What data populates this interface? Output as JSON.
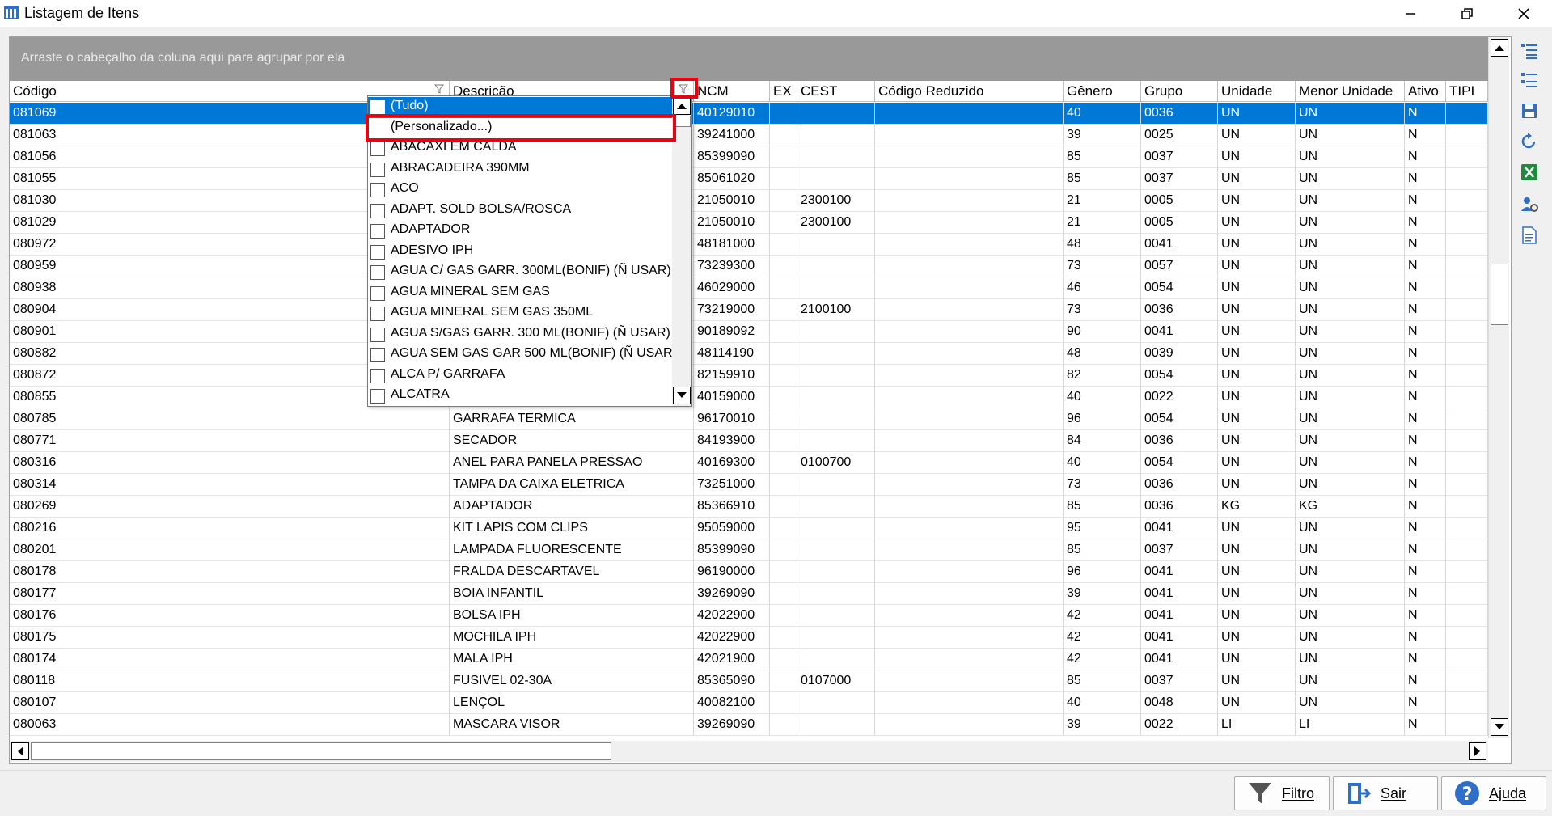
{
  "window": {
    "title": "Listagem de Itens"
  },
  "group_panel": {
    "hint": "Arraste o cabeçalho da coluna aqui para agrupar por ela"
  },
  "columns": [
    "Código",
    "Descrição",
    "NCM",
    "EX",
    "CEST",
    "Código Reduzido",
    "Gênero",
    "Grupo",
    "Unidade",
    "Menor Unidade",
    "Ativo",
    "TIPI"
  ],
  "rows": [
    {
      "codigo": "081069",
      "descricao": "",
      "ncm": "40129010",
      "ex": "",
      "cest": "",
      "reduzido": "",
      "genero": "40",
      "grupo": "0036",
      "unidade": "UN",
      "menor": "UN",
      "ativo": "N",
      "tipi": ""
    },
    {
      "codigo": "081063",
      "descricao": "",
      "ncm": "39241000",
      "ex": "",
      "cest": "",
      "reduzido": "",
      "genero": "39",
      "grupo": "0025",
      "unidade": "UN",
      "menor": "UN",
      "ativo": "N",
      "tipi": ""
    },
    {
      "codigo": "081056",
      "descricao": "",
      "ncm": "85399090",
      "ex": "",
      "cest": "",
      "reduzido": "",
      "genero": "85",
      "grupo": "0037",
      "unidade": "UN",
      "menor": "UN",
      "ativo": "N",
      "tipi": ""
    },
    {
      "codigo": "081055",
      "descricao": "",
      "ncm": "85061020",
      "ex": "",
      "cest": "",
      "reduzido": "",
      "genero": "85",
      "grupo": "0037",
      "unidade": "UN",
      "menor": "UN",
      "ativo": "N",
      "tipi": ""
    },
    {
      "codigo": "081030",
      "descricao": "",
      "ncm": "21050010",
      "ex": "",
      "cest": "2300100",
      "reduzido": "",
      "genero": "21",
      "grupo": "0005",
      "unidade": "UN",
      "menor": "UN",
      "ativo": "N",
      "tipi": ""
    },
    {
      "codigo": "081029",
      "descricao": "",
      "ncm": "21050010",
      "ex": "",
      "cest": "2300100",
      "reduzido": "",
      "genero": "21",
      "grupo": "0005",
      "unidade": "UN",
      "menor": "UN",
      "ativo": "N",
      "tipi": ""
    },
    {
      "codigo": "080972",
      "descricao": "",
      "ncm": "48181000",
      "ex": "",
      "cest": "",
      "reduzido": "",
      "genero": "48",
      "grupo": "0041",
      "unidade": "UN",
      "menor": "UN",
      "ativo": "N",
      "tipi": ""
    },
    {
      "codigo": "080959",
      "descricao": "",
      "ncm": "73239300",
      "ex": "",
      "cest": "",
      "reduzido": "",
      "genero": "73",
      "grupo": "0057",
      "unidade": "UN",
      "menor": "UN",
      "ativo": "N",
      "tipi": ""
    },
    {
      "codigo": "080938",
      "descricao": "",
      "ncm": "46029000",
      "ex": "",
      "cest": "",
      "reduzido": "",
      "genero": "46",
      "grupo": "0054",
      "unidade": "UN",
      "menor": "UN",
      "ativo": "N",
      "tipi": ""
    },
    {
      "codigo": "080904",
      "descricao": "",
      "ncm": "73219000",
      "ex": "",
      "cest": "2100100",
      "reduzido": "",
      "genero": "73",
      "grupo": "0036",
      "unidade": "UN",
      "menor": "UN",
      "ativo": "N",
      "tipi": ""
    },
    {
      "codigo": "080901",
      "descricao": "",
      "ncm": "90189092",
      "ex": "",
      "cest": "",
      "reduzido": "",
      "genero": "90",
      "grupo": "0041",
      "unidade": "UN",
      "menor": "UN",
      "ativo": "N",
      "tipi": ""
    },
    {
      "codigo": "080882",
      "descricao": "",
      "ncm": "48114190",
      "ex": "",
      "cest": "",
      "reduzido": "",
      "genero": "48",
      "grupo": "0039",
      "unidade": "UN",
      "menor": "UN",
      "ativo": "N",
      "tipi": ""
    },
    {
      "codigo": "080872",
      "descricao": "",
      "ncm": "82159910",
      "ex": "",
      "cest": "",
      "reduzido": "",
      "genero": "82",
      "grupo": "0054",
      "unidade": "UN",
      "menor": "UN",
      "ativo": "N",
      "tipi": ""
    },
    {
      "codigo": "080855",
      "descricao": "",
      "ncm": "40159000",
      "ex": "",
      "cest": "",
      "reduzido": "",
      "genero": "40",
      "grupo": "0022",
      "unidade": "UN",
      "menor": "UN",
      "ativo": "N",
      "tipi": ""
    },
    {
      "codigo": "080785",
      "descricao": "GARRAFA TERMICA",
      "ncm": "96170010",
      "ex": "",
      "cest": "",
      "reduzido": "",
      "genero": "96",
      "grupo": "0054",
      "unidade": "UN",
      "menor": "UN",
      "ativo": "N",
      "tipi": ""
    },
    {
      "codigo": "080771",
      "descricao": "SECADOR",
      "ncm": "84193900",
      "ex": "",
      "cest": "",
      "reduzido": "",
      "genero": "84",
      "grupo": "0036",
      "unidade": "UN",
      "menor": "UN",
      "ativo": "N",
      "tipi": ""
    },
    {
      "codigo": "080316",
      "descricao": "ANEL PARA PANELA PRESSAO",
      "ncm": "40169300",
      "ex": "",
      "cest": "0100700",
      "reduzido": "",
      "genero": "40",
      "grupo": "0054",
      "unidade": "UN",
      "menor": "UN",
      "ativo": "N",
      "tipi": ""
    },
    {
      "codigo": "080314",
      "descricao": "TAMPA DA CAIXA ELETRICA",
      "ncm": "73251000",
      "ex": "",
      "cest": "",
      "reduzido": "",
      "genero": "73",
      "grupo": "0036",
      "unidade": "UN",
      "menor": "UN",
      "ativo": "N",
      "tipi": ""
    },
    {
      "codigo": "080269",
      "descricao": "ADAPTADOR",
      "ncm": "85366910",
      "ex": "",
      "cest": "",
      "reduzido": "",
      "genero": "85",
      "grupo": "0036",
      "unidade": "KG",
      "menor": "KG",
      "ativo": "N",
      "tipi": ""
    },
    {
      "codigo": "080216",
      "descricao": "KIT LAPIS COM CLIPS",
      "ncm": "95059000",
      "ex": "",
      "cest": "",
      "reduzido": "",
      "genero": "95",
      "grupo": "0041",
      "unidade": "UN",
      "menor": "UN",
      "ativo": "N",
      "tipi": ""
    },
    {
      "codigo": "080201",
      "descricao": "LAMPADA FLUORESCENTE",
      "ncm": "85399090",
      "ex": "",
      "cest": "",
      "reduzido": "",
      "genero": "85",
      "grupo": "0037",
      "unidade": "UN",
      "menor": "UN",
      "ativo": "N",
      "tipi": ""
    },
    {
      "codigo": "080178",
      "descricao": "FRALDA DESCARTAVEL",
      "ncm": "96190000",
      "ex": "",
      "cest": "",
      "reduzido": "",
      "genero": "96",
      "grupo": "0041",
      "unidade": "UN",
      "menor": "UN",
      "ativo": "N",
      "tipi": ""
    },
    {
      "codigo": "080177",
      "descricao": "BOIA INFANTIL",
      "ncm": "39269090",
      "ex": "",
      "cest": "",
      "reduzido": "",
      "genero": "39",
      "grupo": "0041",
      "unidade": "UN",
      "menor": "UN",
      "ativo": "N",
      "tipi": ""
    },
    {
      "codigo": "080176",
      "descricao": "BOLSA IPH",
      "ncm": "42022900",
      "ex": "",
      "cest": "",
      "reduzido": "",
      "genero": "42",
      "grupo": "0041",
      "unidade": "UN",
      "menor": "UN",
      "ativo": "N",
      "tipi": ""
    },
    {
      "codigo": "080175",
      "descricao": "MOCHILA IPH",
      "ncm": "42022900",
      "ex": "",
      "cest": "",
      "reduzido": "",
      "genero": "42",
      "grupo": "0041",
      "unidade": "UN",
      "menor": "UN",
      "ativo": "N",
      "tipi": ""
    },
    {
      "codigo": "080174",
      "descricao": "MALA IPH",
      "ncm": "42021900",
      "ex": "",
      "cest": "",
      "reduzido": "",
      "genero": "42",
      "grupo": "0041",
      "unidade": "UN",
      "menor": "UN",
      "ativo": "N",
      "tipi": ""
    },
    {
      "codigo": "080118",
      "descricao": "FUSIVEL 02-30A",
      "ncm": "85365090",
      "ex": "",
      "cest": "0107000",
      "reduzido": "",
      "genero": "85",
      "grupo": "0037",
      "unidade": "UN",
      "menor": "UN",
      "ativo": "N",
      "tipi": ""
    },
    {
      "codigo": "080107",
      "descricao": "LENÇOL",
      "ncm": "40082100",
      "ex": "",
      "cest": "",
      "reduzido": "",
      "genero": "40",
      "grupo": "0048",
      "unidade": "UN",
      "menor": "UN",
      "ativo": "N",
      "tipi": ""
    },
    {
      "codigo": "080063",
      "descricao": "MASCARA VISOR",
      "ncm": "39269090",
      "ex": "",
      "cest": "",
      "reduzido": "",
      "genero": "39",
      "grupo": "0022",
      "unidade": "LI",
      "menor": "LI",
      "ativo": "N",
      "tipi": ""
    }
  ],
  "filter_dropdown": {
    "items": [
      "(Tudo)",
      "(Personalizado...)",
      "ABACAXI EM CALDA",
      "ABRACADEIRA 390MM",
      "ACO",
      "ADAPT. SOLD BOLSA/ROSCA",
      "ADAPTADOR",
      "ADESIVO IPH",
      "AGUA C/ GAS GARR. 300ML(BONIF) (Ñ USAR)",
      "AGUA MINERAL SEM GAS",
      "AGUA MINERAL SEM GAS 350ML",
      "AGUA S/GAS GARR. 300 ML(BONIF) (Ñ USAR)",
      "AGUA SEM GAS GAR 500 ML(BONIF) (Ñ USAR)",
      "ALCA P/ GARRAFA",
      "ALCATRA"
    ]
  },
  "buttons": {
    "filtro": "Filtro",
    "sair": "Sair",
    "ajuda": "Ajuda"
  },
  "colors": {
    "selection": "#0078d7",
    "highlight": "#e30613",
    "group_panel": "#999999"
  }
}
